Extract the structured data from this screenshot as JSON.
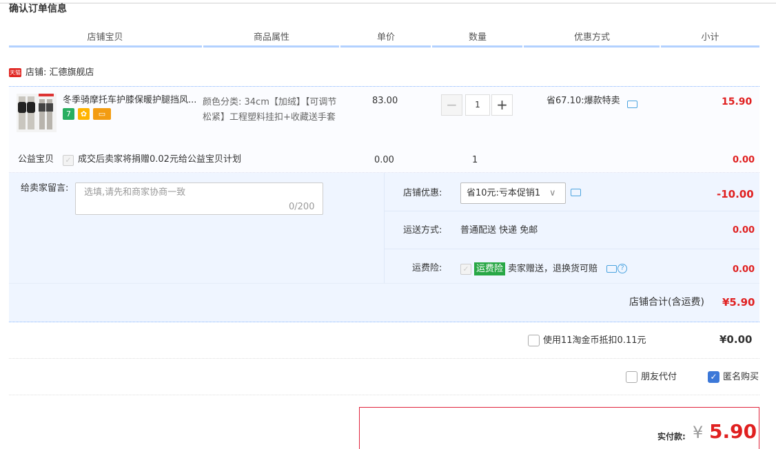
{
  "page": {
    "title": "确认订单信息"
  },
  "columns": [
    "店铺宝贝",
    "商品属性",
    "单价",
    "数量",
    "优惠方式",
    "小计"
  ],
  "shop": {
    "logo_text": "天猫",
    "label": "店铺: 汇德旗舰店"
  },
  "item": {
    "title": "冬季骑摩托车护膝保暖护腿挡风...",
    "badges": [
      "7",
      "✿",
      "▭"
    ],
    "attributes": "颜色分类: 34cm【加绒】【可调节松紧】工程塑料挂扣+收藏送手套",
    "price": "83.00",
    "quantity": "1",
    "minus_label": "−",
    "plus_label": "+",
    "discount": "省67.10:爆款特卖",
    "subtotal": "15.90"
  },
  "charity": {
    "label": "公益宝贝",
    "text": "成交后卖家将捐赠0.02元给公益宝贝计划",
    "price": "0.00",
    "quantity": "1",
    "subtotal": "0.00"
  },
  "message": {
    "label": "给卖家留言:",
    "placeholder": "选填,请先和商家协商一致",
    "counter": "0/200"
  },
  "shop_discount": {
    "label": "店铺优惠:",
    "selected": "省10元:亏本促销1",
    "amount": "-10.00"
  },
  "shipping": {
    "label": "运送方式:",
    "value": "普通配送 快递 免邮",
    "amount": "0.00"
  },
  "insurance": {
    "label": "运费险:",
    "tag": "运费险",
    "text": "卖家赠送，退换货可赔",
    "amount": "0.00"
  },
  "shop_total": {
    "label": "店铺合计(含运费)",
    "value": "¥5.90"
  },
  "coins": {
    "label": "使用11淘金币抵扣0.11元",
    "value": "¥0.00"
  },
  "options": {
    "friend_pay": "朋友代付",
    "anonymous": "匿名购买"
  },
  "payment": {
    "label": "实付款:",
    "currency": "¥",
    "amount": "5.90"
  },
  "colors": {
    "accent_red": "#e02020",
    "blue_border": "#b2d1ff",
    "panel_bg": "#eff5ff",
    "tag_green": "#28a745"
  }
}
